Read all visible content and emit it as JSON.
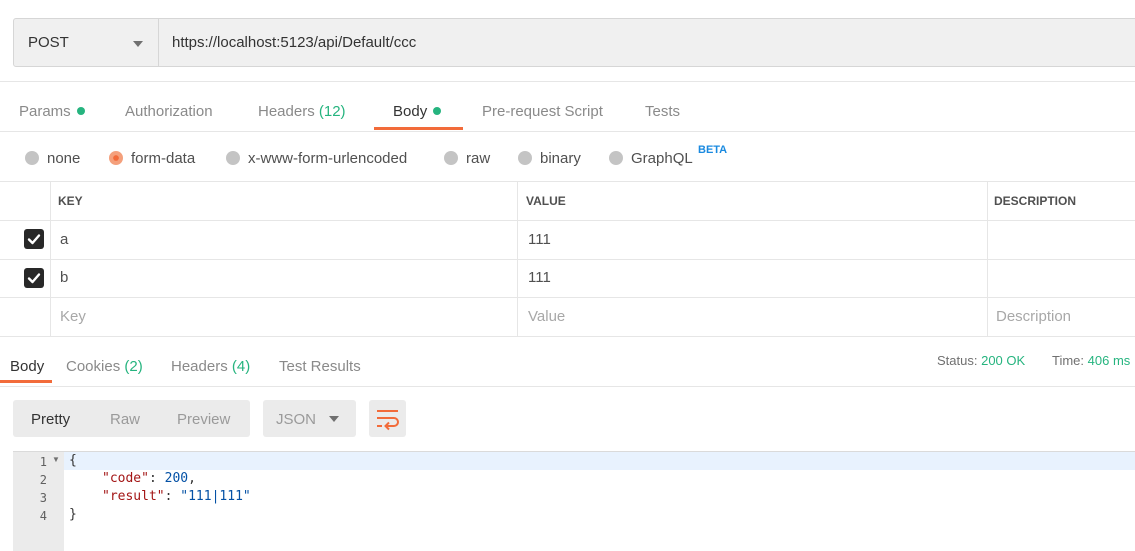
{
  "request": {
    "method": "POST",
    "url": "https://localhost:5123/api/Default/ccc"
  },
  "request_tabs": [
    {
      "label": "Params",
      "dot": true
    },
    {
      "label": "Authorization"
    },
    {
      "label": "Headers",
      "count": "(12)"
    },
    {
      "label": "Body",
      "dot": true,
      "active": true
    },
    {
      "label": "Pre-request Script"
    },
    {
      "label": "Tests"
    }
  ],
  "body_types": [
    {
      "label": "none"
    },
    {
      "label": "form-data",
      "selected": true
    },
    {
      "label": "x-www-form-urlencoded"
    },
    {
      "label": "raw"
    },
    {
      "label": "binary"
    },
    {
      "label": "GraphQL",
      "badge": "BETA"
    }
  ],
  "table": {
    "headers": [
      "KEY",
      "VALUE",
      "DESCRIPTION"
    ],
    "rows": [
      {
        "checked": true,
        "key": "a",
        "value": "111",
        "description": ""
      },
      {
        "checked": true,
        "key": "b",
        "value": "111",
        "description": ""
      }
    ],
    "placeholders": {
      "key": "Key",
      "value": "Value",
      "description": "Description"
    }
  },
  "response_tabs": [
    {
      "label": "Body",
      "active": true
    },
    {
      "label": "Cookies",
      "count": "(2)"
    },
    {
      "label": "Headers",
      "count": "(4)"
    },
    {
      "label": "Test Results"
    }
  ],
  "status": {
    "status_label": "Status:",
    "status_value": "200 OK",
    "time_label": "Time:",
    "time_value": "406 ms"
  },
  "view_modes": [
    "Pretty",
    "Raw",
    "Preview"
  ],
  "format": "JSON",
  "colors": {
    "accent": "#f26b3a",
    "success": "#26b47f",
    "beta": "#1a8ae0"
  },
  "code": {
    "line_numbers": [
      "1",
      "2",
      "3",
      "4"
    ],
    "open_brace": "{",
    "close_brace": "}",
    "key_code": "\"code\"",
    "val_code": "200",
    "key_result": "\"result\"",
    "val_result": "\"111|111\""
  }
}
